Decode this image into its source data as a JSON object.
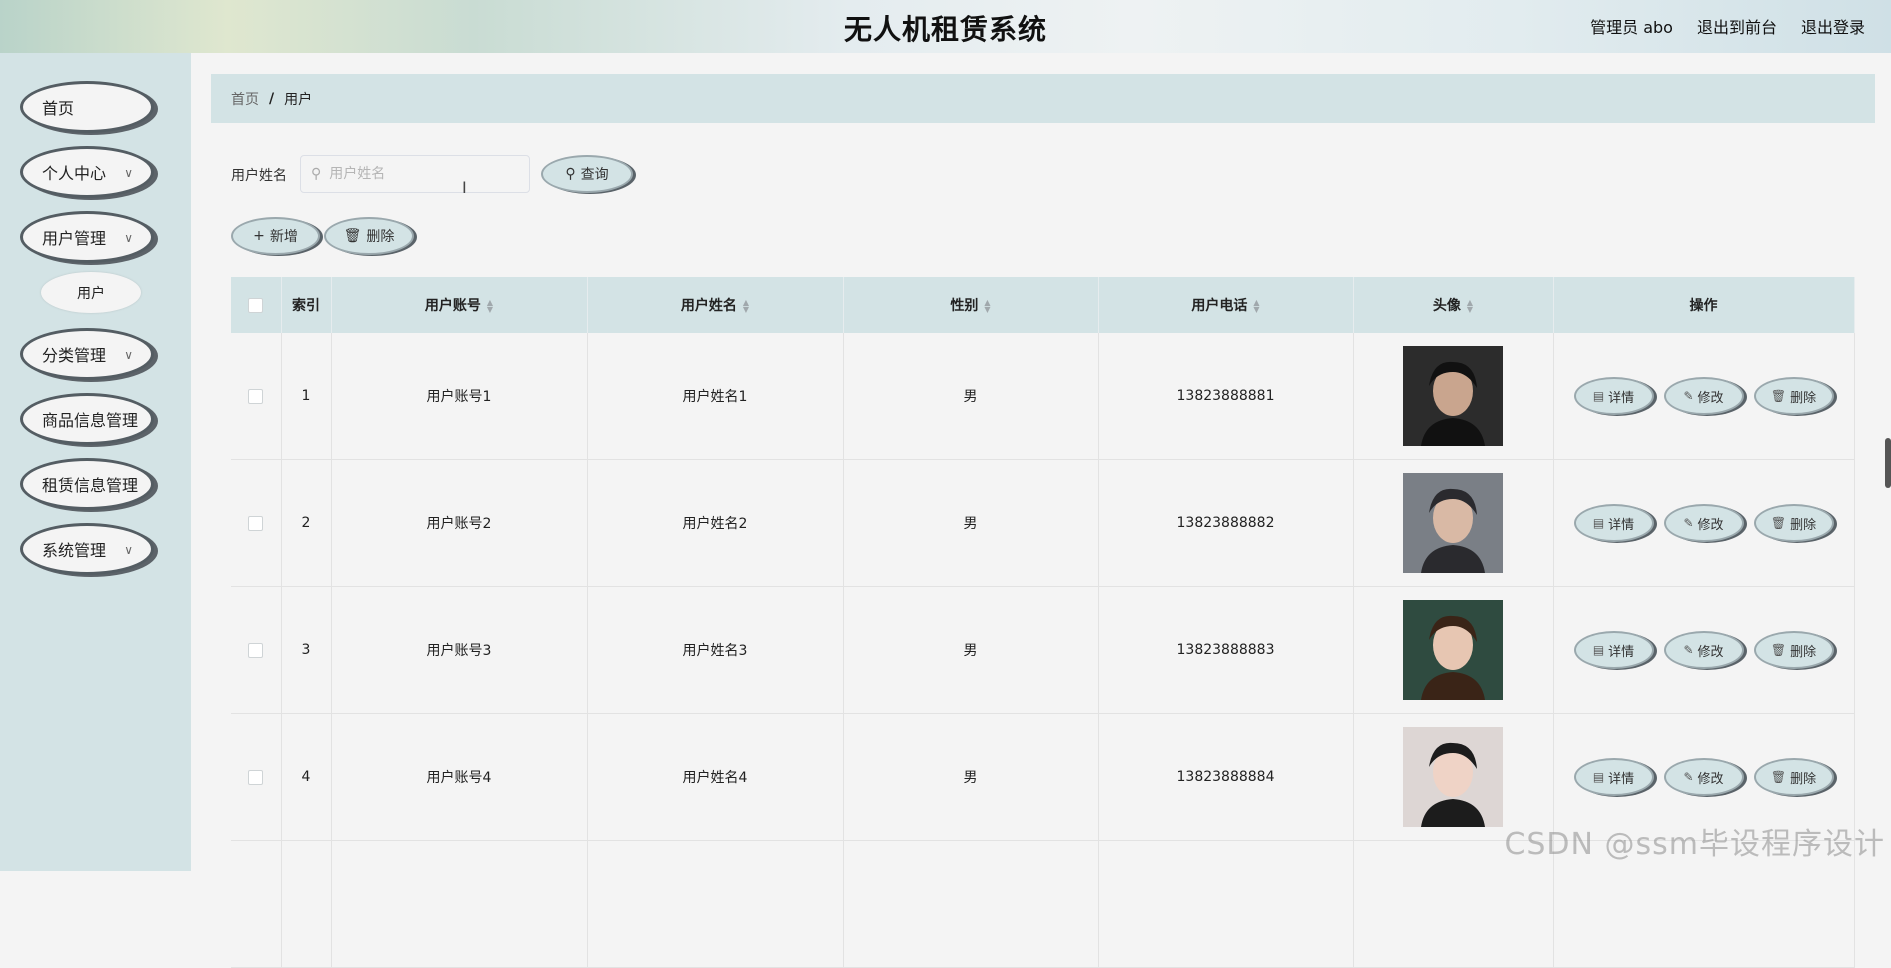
{
  "header": {
    "title": "无人机租赁系统",
    "user_label": "管理员 abo",
    "front_link": "退出到前台",
    "logout_link": "退出登录"
  },
  "sidebar": {
    "items": [
      {
        "label": "首页"
      },
      {
        "label": "个人中心"
      },
      {
        "label": "用户管理"
      },
      {
        "label": "用户"
      },
      {
        "label": "分类管理"
      },
      {
        "label": "商品信息管理"
      },
      {
        "label": "租赁信息管理"
      },
      {
        "label": "系统管理"
      }
    ]
  },
  "breadcrumb": {
    "home": "首页",
    "sep": "/",
    "current": "用户"
  },
  "search": {
    "label": "用户姓名",
    "placeholder": "用户姓名",
    "button": "查询"
  },
  "actions": {
    "add": "新增",
    "delete": "删除"
  },
  "table": {
    "headers": [
      "索引",
      "用户账号",
      "用户姓名",
      "性别",
      "用户电话",
      "头像",
      "操作"
    ],
    "rows": [
      {
        "index": "1",
        "account": "用户账号1",
        "name": "用户姓名1",
        "gender": "男",
        "phone": "13823888881"
      },
      {
        "index": "2",
        "account": "用户账号2",
        "name": "用户姓名2",
        "gender": "男",
        "phone": "13823888882"
      },
      {
        "index": "3",
        "account": "用户账号3",
        "name": "用户姓名3",
        "gender": "男",
        "phone": "13823888883"
      },
      {
        "index": "4",
        "account": "用户账号4",
        "name": "用户姓名4",
        "gender": "男",
        "phone": "13823888884"
      }
    ],
    "row_actions": {
      "detail": "详情",
      "edit": "修改",
      "delete": "删除"
    }
  },
  "watermark": "CSDN @ssm毕设程序设计"
}
